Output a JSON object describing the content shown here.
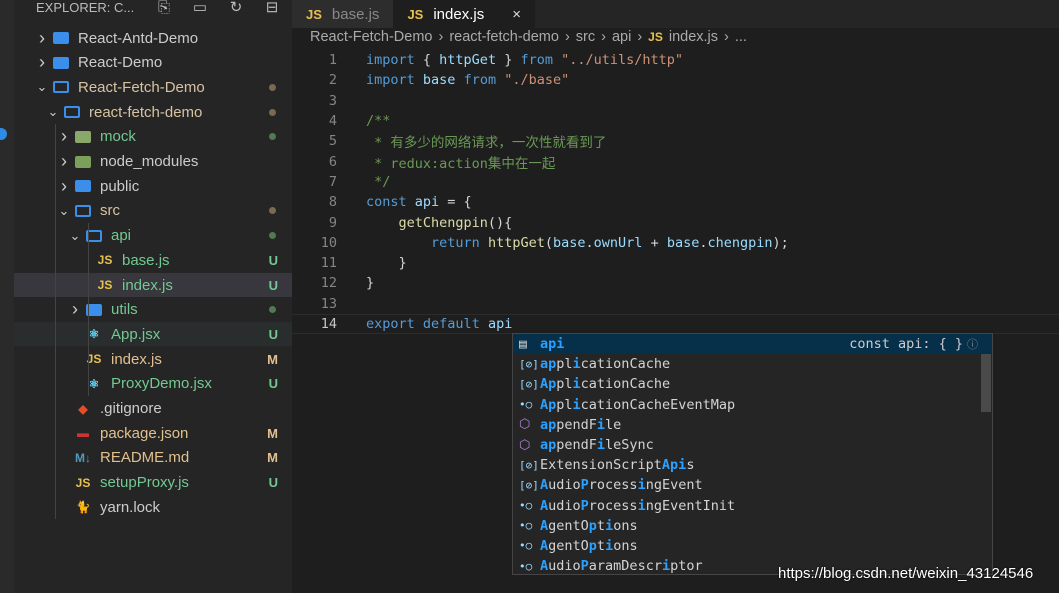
{
  "explorer": {
    "title": "EXPLORER: C...",
    "icons": [
      "new-file-icon",
      "new-folder-icon",
      "refresh-icon",
      "collapse-all-icon"
    ]
  },
  "tree": [
    {
      "label": "React-Antd-Demo",
      "depth": 0,
      "chev": ">",
      "icon": "folder",
      "color": "#cccccc",
      "badge": ""
    },
    {
      "label": "React-Demo",
      "depth": 0,
      "chev": ">",
      "icon": "folder",
      "color": "#cccccc",
      "badge": ""
    },
    {
      "label": "React-Fetch-Demo",
      "depth": 0,
      "chev": "v",
      "icon": "folder-open",
      "color": "#d7c3a2",
      "badge": "dot"
    },
    {
      "label": "react-fetch-demo",
      "depth": 1,
      "chev": "v",
      "icon": "folder-open",
      "color": "#d7c3a2",
      "badge": "dot"
    },
    {
      "label": "mock",
      "depth": 2,
      "chev": ">",
      "icon": "folder-mock",
      "color": "#73c991",
      "badge": "dotg"
    },
    {
      "label": "node_modules",
      "depth": 2,
      "chev": ">",
      "icon": "folder-node",
      "color": "#cccccc",
      "badge": ""
    },
    {
      "label": "public",
      "depth": 2,
      "chev": ">",
      "icon": "folder",
      "color": "#cccccc",
      "badge": ""
    },
    {
      "label": "src",
      "depth": 2,
      "chev": "v",
      "icon": "folder-open",
      "color": "#d7c3a2",
      "badge": "dot"
    },
    {
      "label": "api",
      "depth": 3,
      "chev": "v",
      "icon": "folder-open",
      "color": "#73c991",
      "badge": "dotg"
    },
    {
      "label": "base.js",
      "depth": 4,
      "chev": "",
      "icon": "js",
      "color": "#73c991",
      "badge": "U"
    },
    {
      "label": "index.js",
      "depth": 4,
      "chev": "",
      "icon": "js",
      "color": "#73c991",
      "badge": "U",
      "selected": true
    },
    {
      "label": "utils",
      "depth": 3,
      "chev": ">",
      "icon": "folder",
      "color": "#73c991",
      "badge": "dotg"
    },
    {
      "label": "App.jsx",
      "depth": 3,
      "chev": "",
      "icon": "react",
      "color": "#73c991",
      "badge": "U",
      "hover": true
    },
    {
      "label": "index.js",
      "depth": 3,
      "chev": "",
      "icon": "js",
      "color": "#e2c08d",
      "badge": "M"
    },
    {
      "label": "ProxyDemo.jsx",
      "depth": 3,
      "chev": "",
      "icon": "react",
      "color": "#73c991",
      "badge": "U"
    },
    {
      "label": ".gitignore",
      "depth": 2,
      "chev": "",
      "icon": "git",
      "color": "#cccccc",
      "badge": ""
    },
    {
      "label": "package.json",
      "depth": 2,
      "chev": "",
      "icon": "npm",
      "color": "#e2c08d",
      "badge": "M"
    },
    {
      "label": "README.md",
      "depth": 2,
      "chev": "",
      "icon": "markdown",
      "color": "#e2c08d",
      "badge": "M"
    },
    {
      "label": "setupProxy.js",
      "depth": 2,
      "chev": "",
      "icon": "js",
      "color": "#73c991",
      "badge": "U"
    },
    {
      "label": "yarn.lock",
      "depth": 2,
      "chev": "",
      "icon": "yarn",
      "color": "#cccccc",
      "badge": ""
    }
  ],
  "tabs": [
    {
      "label": "base.js",
      "icon": "JS",
      "active": false
    },
    {
      "label": "index.js",
      "icon": "JS",
      "active": true,
      "close": "×"
    }
  ],
  "breadcrumb": [
    "React-Fetch-Demo",
    "react-fetch-demo",
    "src",
    "api",
    "JS",
    "index.js",
    "..."
  ],
  "code": [
    [
      [
        "k",
        "import"
      ],
      [
        "p",
        " { "
      ],
      [
        "v",
        "httpGet"
      ],
      [
        "p",
        " } "
      ],
      [
        "k",
        "from"
      ],
      [
        "p",
        " "
      ],
      [
        "s",
        "\"../utils/http\""
      ]
    ],
    [
      [
        "k",
        "import"
      ],
      [
        "p",
        " "
      ],
      [
        "v",
        "base"
      ],
      [
        "p",
        " "
      ],
      [
        "k",
        "from"
      ],
      [
        "p",
        " "
      ],
      [
        "s",
        "\"./base\""
      ]
    ],
    [],
    [
      [
        "c",
        "/**"
      ]
    ],
    [
      [
        "c",
        " * 有多少的网络请求，一次性就看到了"
      ]
    ],
    [
      [
        "c",
        " * redux:action集中在一起"
      ]
    ],
    [
      [
        "c",
        " */"
      ]
    ],
    [
      [
        "k",
        "const"
      ],
      [
        "p",
        " "
      ],
      [
        "v",
        "api"
      ],
      [
        "p",
        " = {"
      ]
    ],
    [
      [
        "p",
        "    "
      ],
      [
        "f",
        "getChengpin"
      ],
      [
        "p",
        "(){"
      ]
    ],
    [
      [
        "p",
        "        "
      ],
      [
        "k",
        "return"
      ],
      [
        "p",
        " "
      ],
      [
        "f",
        "httpGet"
      ],
      [
        "p",
        "("
      ],
      [
        "v",
        "base"
      ],
      [
        "p",
        "."
      ],
      [
        "v",
        "ownUrl"
      ],
      [
        "p",
        " + "
      ],
      [
        "v",
        "base"
      ],
      [
        "p",
        "."
      ],
      [
        "v",
        "chengpin"
      ],
      [
        "p",
        ");"
      ]
    ],
    [
      [
        "p",
        "    }"
      ]
    ],
    [
      [
        "p",
        "}"
      ]
    ],
    [],
    [
      [
        "k",
        "export"
      ],
      [
        "p",
        " "
      ],
      [
        "k",
        "default"
      ],
      [
        "p",
        " "
      ],
      [
        "v",
        "api"
      ]
    ]
  ],
  "current_line": 14,
  "suggestions": [
    {
      "icon": "variable",
      "parts": [
        [
          "api",
          1
        ]
      ],
      "detail": "const api: { }"
    },
    {
      "icon": "field",
      "parts": [
        [
          "ap",
          1
        ],
        [
          "pl",
          0
        ],
        [
          "i",
          1
        ],
        [
          "cationCache",
          0
        ]
      ]
    },
    {
      "icon": "field",
      "parts": [
        [
          "Ap",
          1
        ],
        [
          "pl",
          0
        ],
        [
          "i",
          1
        ],
        [
          "cationCache",
          0
        ]
      ]
    },
    {
      "icon": "interface",
      "parts": [
        [
          "Ap",
          1
        ],
        [
          "pl",
          0
        ],
        [
          "i",
          1
        ],
        [
          "cationCacheEventMap",
          0
        ]
      ]
    },
    {
      "icon": "method",
      "parts": [
        [
          "ap",
          1
        ],
        [
          "pendF",
          0
        ],
        [
          "i",
          1
        ],
        [
          "le",
          0
        ]
      ]
    },
    {
      "icon": "method",
      "parts": [
        [
          "ap",
          1
        ],
        [
          "pendF",
          0
        ],
        [
          "i",
          1
        ],
        [
          "leSync",
          0
        ]
      ]
    },
    {
      "icon": "field",
      "parts": [
        [
          "ExtensionScript",
          0
        ],
        [
          "Api",
          1
        ],
        [
          "s",
          0
        ]
      ]
    },
    {
      "icon": "field",
      "parts": [
        [
          "A",
          1
        ],
        [
          "udio",
          0
        ],
        [
          "P",
          1
        ],
        [
          "rocess",
          0
        ],
        [
          "i",
          1
        ],
        [
          "ngEvent",
          0
        ]
      ]
    },
    {
      "icon": "interface",
      "parts": [
        [
          "A",
          1
        ],
        [
          "udio",
          0
        ],
        [
          "P",
          1
        ],
        [
          "rocess",
          0
        ],
        [
          "i",
          1
        ],
        [
          "ngEventInit",
          0
        ]
      ]
    },
    {
      "icon": "interface",
      "parts": [
        [
          "A",
          1
        ],
        [
          "gentO",
          0
        ],
        [
          "p",
          1
        ],
        [
          "t",
          0
        ],
        [
          "i",
          1
        ],
        [
          "ons",
          0
        ]
      ]
    },
    {
      "icon": "interface",
      "parts": [
        [
          "A",
          1
        ],
        [
          "gentO",
          0
        ],
        [
          "p",
          1
        ],
        [
          "t",
          0
        ],
        [
          "i",
          1
        ],
        [
          "ons",
          0
        ]
      ]
    },
    {
      "icon": "interface",
      "parts": [
        [
          "A",
          1
        ],
        [
          "udio",
          0
        ],
        [
          "P",
          1
        ],
        [
          "aramDescr",
          0
        ],
        [
          "i",
          1
        ],
        [
          "ptor",
          0
        ]
      ]
    }
  ],
  "watermark": "https://blog.csdn.net/weixin_43124546"
}
